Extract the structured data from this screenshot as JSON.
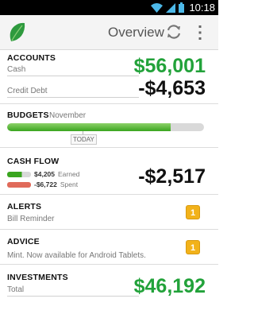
{
  "status_bar": {
    "time": "10:18",
    "icons": [
      "wifi-icon",
      "signal-icon",
      "battery-icon"
    ]
  },
  "action_bar": {
    "title": "Overview",
    "logo": "mint-leaf-logo",
    "refresh_icon": "refresh-icon",
    "overflow_icon": "overflow-menu-icon"
  },
  "accounts": {
    "heading": "ACCOUNTS",
    "cash_label": "Cash",
    "cash_value": "$56,001",
    "credit_label": "Credit Debt",
    "credit_value": "-$4,653"
  },
  "budgets": {
    "heading": "BUDGETS",
    "month": "November",
    "progress": 0.83,
    "today_label": "TODAY"
  },
  "cash_flow": {
    "heading": "CASH FLOW",
    "earned_amount": "$4,205",
    "earned_label": "Earned",
    "spent_amount": "-$6,722",
    "spent_label": "Spent",
    "net_value": "-$2,517"
  },
  "alerts": {
    "heading": "ALERTS",
    "text": "Bill Reminder",
    "count": "1"
  },
  "advice": {
    "heading": "ADVICE",
    "text": "Mint. Now available for Android Tablets.",
    "count": "1"
  },
  "investments": {
    "heading": "INVESTMENTS",
    "total_label": "Total",
    "value": "$46,192"
  },
  "colors": {
    "accent_green": "#22a23a",
    "badge": "#f2b21a",
    "spent_red": "#e06a5a"
  }
}
